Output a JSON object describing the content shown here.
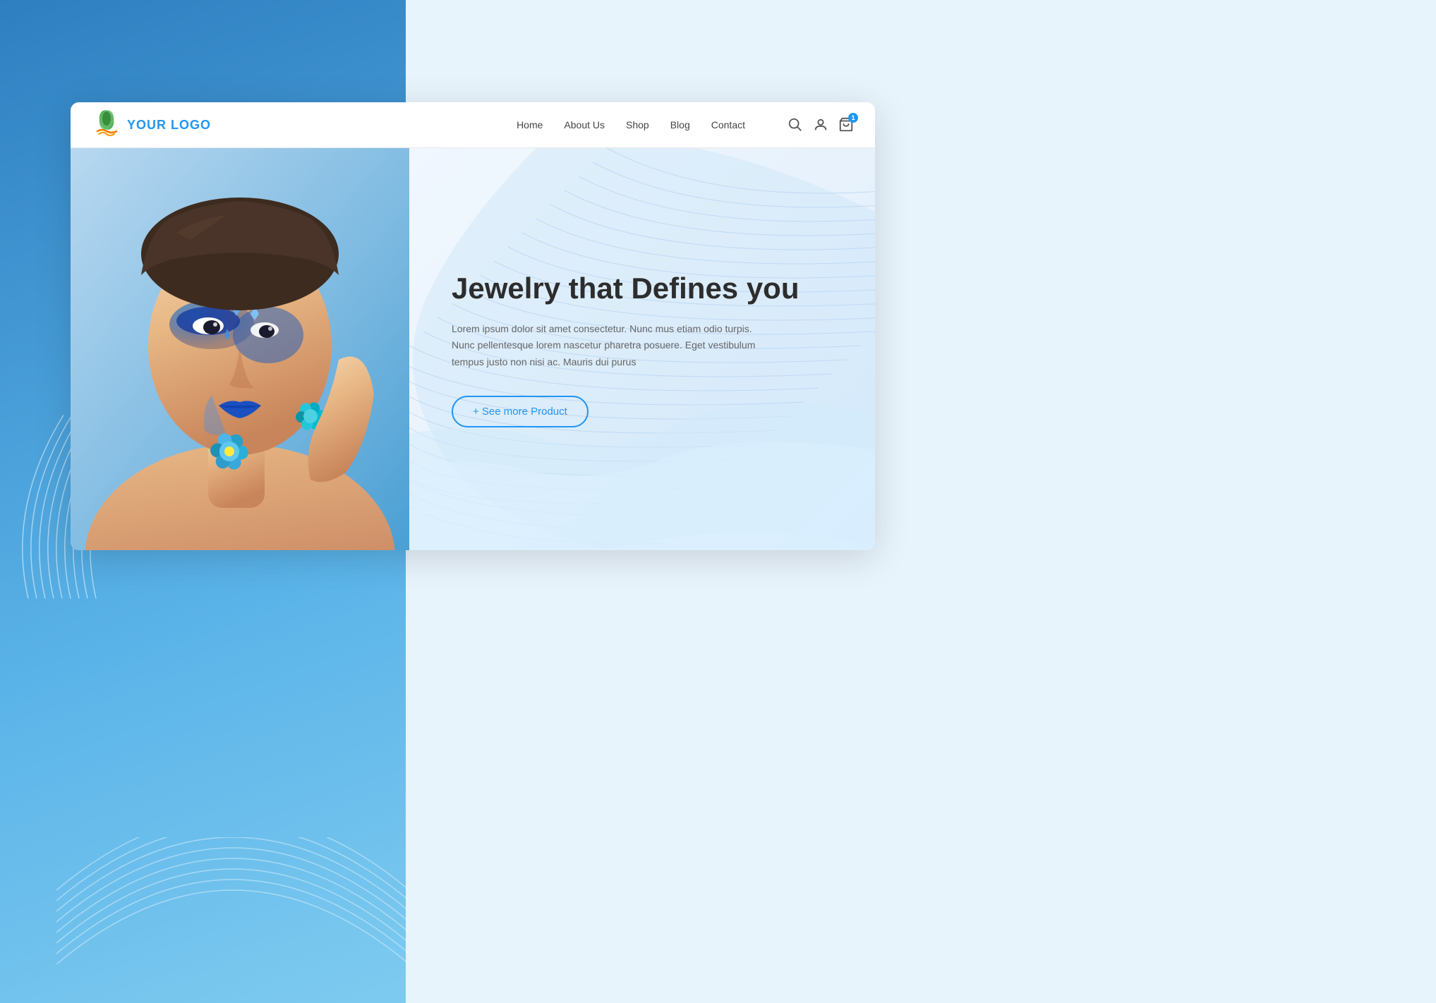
{
  "background": {
    "blue_color": "#4a9fd4",
    "right_color": "#e8f4fc"
  },
  "logo": {
    "text": "YOUR LOGO",
    "icon_alt": "leaf-logo"
  },
  "navbar": {
    "links": [
      {
        "label": "Home",
        "id": "home"
      },
      {
        "label": "About Us",
        "id": "about"
      },
      {
        "label": "Shop",
        "id": "shop"
      },
      {
        "label": "Blog",
        "id": "blog"
      },
      {
        "label": "Contact",
        "id": "contact"
      }
    ],
    "cart_badge": "1"
  },
  "hero": {
    "title": "Jewelry that Defines you",
    "description": "Lorem ipsum dolor sit amet consectetur. Nunc mus etiam odio turpis. Nunc pellentesque lorem nascetur pharetra posuere. Eget vestibulum tempus justo non nisi ac. Mauris dui purus",
    "cta_button": "+ See more Product"
  }
}
